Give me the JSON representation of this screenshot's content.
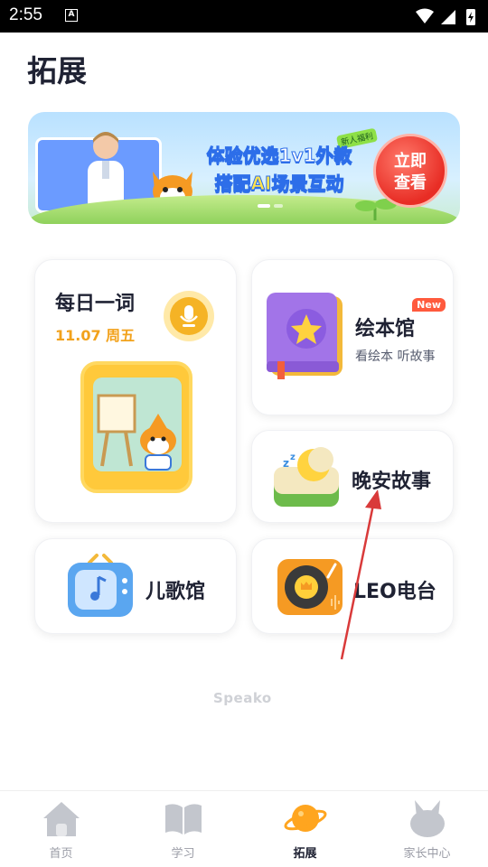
{
  "status_bar": {
    "time": "2:55",
    "notification": "A"
  },
  "page": {
    "title": "拓展"
  },
  "banner": {
    "line1": "体验优选1v1外教",
    "line2_prefix": "搭配",
    "line2_highlight": "AI场景互动",
    "tag": "新人福利",
    "cta_line1": "立即",
    "cta_line2": "查看"
  },
  "cards": {
    "daily": {
      "title": "每日一词",
      "date": "11.07 周五"
    },
    "picbook": {
      "name": "绘本馆",
      "badge": "New",
      "subtitle": "看绘本 听故事"
    },
    "goodnight": {
      "name": "晚安故事"
    },
    "songs": {
      "name": "儿歌馆"
    },
    "radio": {
      "name": "LEO电台"
    }
  },
  "brand": "Speako",
  "tabs": [
    {
      "label": "首页"
    },
    {
      "label": "学习"
    },
    {
      "label": "拓展"
    },
    {
      "label": "家长中心"
    }
  ],
  "colors": {
    "accent_orange": "#f5b325",
    "active_tab": "#ffa51f",
    "cta_red": "#e82d25"
  }
}
